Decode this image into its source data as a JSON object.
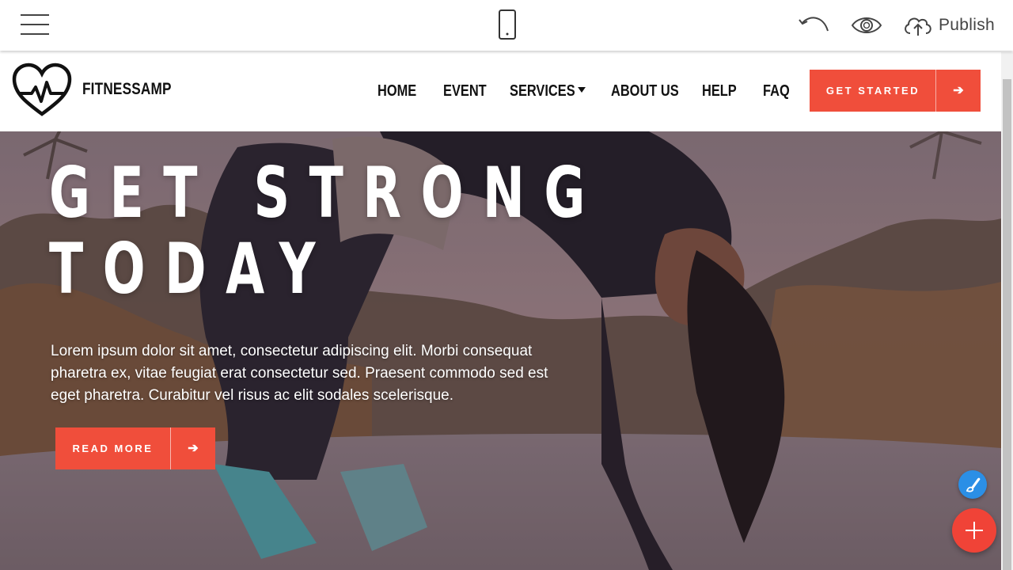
{
  "editor": {
    "publish_label": "Publish",
    "icons": [
      "hamburger-icon",
      "mobile-device-icon",
      "undo-icon",
      "eye-icon",
      "cloud-upload-icon"
    ]
  },
  "site": {
    "brand": "FITNESSAMP",
    "menu": {
      "home": "HOME",
      "event": "EVENT",
      "services": "SERVICES",
      "about": "ABOUT US",
      "help": "HELP",
      "faq": "FAQ"
    },
    "cta_label": "GET STARTED"
  },
  "hero": {
    "title_line1": "GET STRONG",
    "title_line2": "TODAY",
    "text": "Lorem ipsum dolor sit amet, consectetur adipiscing elit. Morbi consequat pharetra ex, vitae feugiat erat consectetur sed. Praesent commodo sed est eget pharetra. Curabitur vel risus ac elit sodales scelerisque.",
    "button_label": "READ MORE"
  },
  "colors": {
    "accent": "#f04e3b",
    "fab_brush": "#2b8fe6",
    "fab_add": "#f04337",
    "nav_text": "#111111"
  }
}
